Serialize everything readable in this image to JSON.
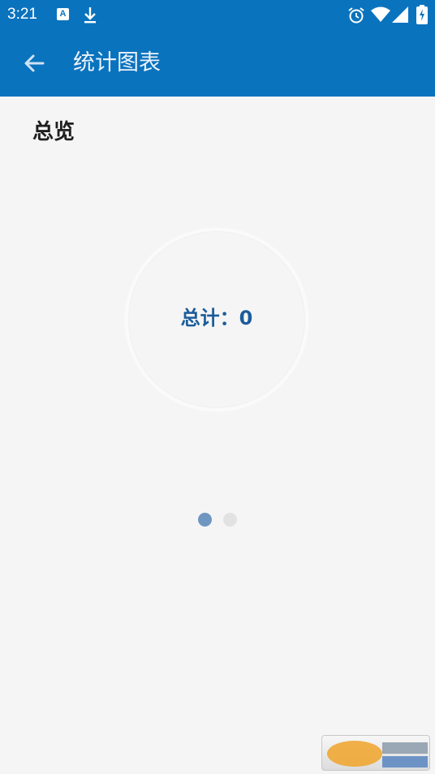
{
  "status_bar": {
    "time": "3:21",
    "icons": [
      "a-notification-icon",
      "download-icon",
      "alarm-icon",
      "wifi-icon",
      "signal-icon",
      "battery-icon"
    ]
  },
  "app_bar": {
    "title": "统计图表",
    "back_icon": "arrow-left-icon"
  },
  "overview": {
    "title": "总览",
    "total_label": "总计：0"
  },
  "chart_data": {
    "type": "pie",
    "categories": [],
    "values": [],
    "title": ""
  },
  "pager": {
    "pages": 2,
    "current": 1
  },
  "watermark": {
    "type": "logo"
  },
  "colors": {
    "primary": "#0a73be",
    "background": "#f5f5f5",
    "total_text": "#1a5c9a",
    "dot_active": "#6f96c1",
    "dot_inactive": "#e2e2e2"
  }
}
